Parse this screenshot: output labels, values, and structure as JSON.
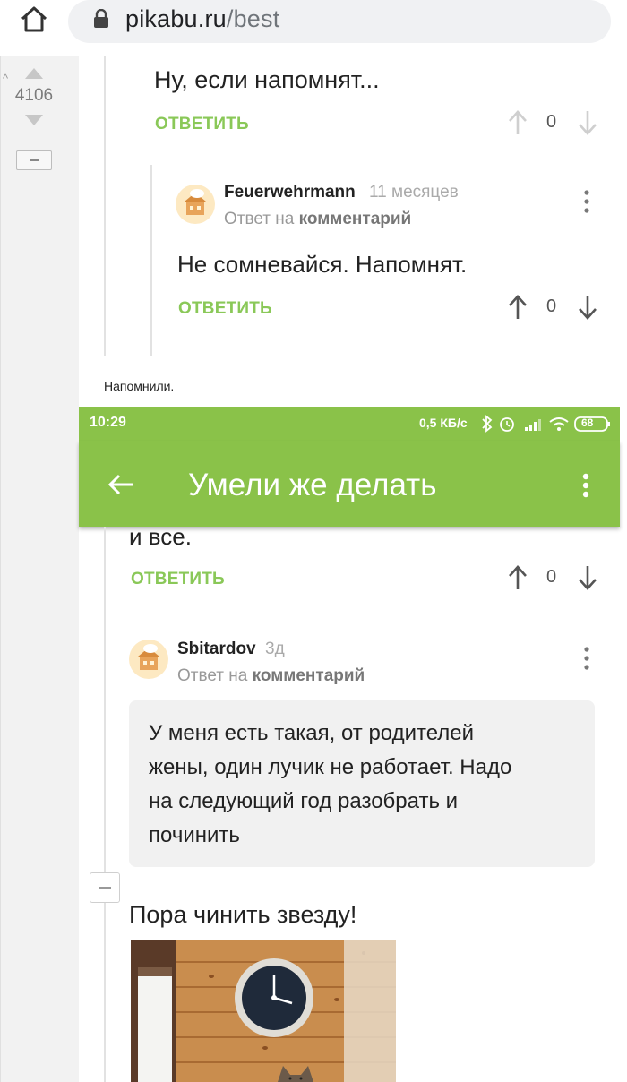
{
  "browser": {
    "url_host": "pikabu.ru",
    "url_path": "/best"
  },
  "sidebar": {
    "rating": "4106"
  },
  "comments": [
    {
      "text": "Ну, если напомнят...",
      "reply_label": "ОТВЕТИТЬ",
      "votes": "0"
    },
    {
      "author": "Feuerwehrmann",
      "time": "11 месяцев",
      "reply_to_prefix": "Ответ на",
      "reply_to_link": "комментарий",
      "text": "Не сомневайся. Напомнят.",
      "reply_label": "ОТВЕТИТЬ",
      "votes": "0"
    }
  ],
  "caption": "Напомнили.",
  "phone": {
    "status_time": "10:29",
    "status_speed": "0,5 КБ/с",
    "battery": "68",
    "app_title": "Умели же делать",
    "comments": [
      {
        "text": "и все.",
        "reply_label": "ОТВЕТИТЬ",
        "votes": "0"
      },
      {
        "author": "Sbitardov",
        "time": "3д",
        "reply_to_prefix": "Ответ на",
        "reply_to_link": "комментарий",
        "text_lines": [
          "У меня есть такая, от родителей",
          "жены, один лучик не работает. Надо",
          "на следующий год разобрать и",
          "починить"
        ]
      }
    ],
    "post_text": "Пора чинить звезду!"
  },
  "colors": {
    "accent_green": "#8ac249",
    "reply_green": "#8ac858"
  },
  "icons": [
    "home-icon",
    "lock-icon",
    "arrow-up-icon",
    "arrow-down-icon",
    "kebab-menu-icon",
    "back-arrow-icon",
    "bluetooth-icon",
    "alarm-icon",
    "signal-icon",
    "wifi-icon",
    "battery-icon"
  ]
}
